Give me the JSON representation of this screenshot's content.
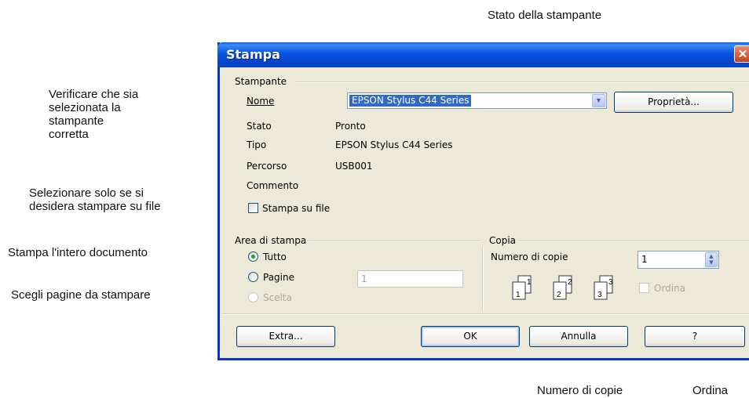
{
  "annotations": {
    "printer_status": "Stato della stampante",
    "verify_printer": "Verificare che sia\nselezionata la\nstampante\ncorretta",
    "print_to_file_hint": "Selezionare solo se si\ndesidera stampare su file",
    "print_all_hint": "Stampa l'intero documento",
    "choose_pages_hint": "Scegli pagine da stampare",
    "copies_hint": "Numero di copie",
    "collate_hint": "Ordina"
  },
  "dialog": {
    "title": "Stampa",
    "close_icon": "close-icon",
    "printer_group": {
      "title": "Stampante",
      "name_label": "Nome",
      "name_value": "EPSON Stylus C44 Series",
      "properties_button": "Proprietà...",
      "status_label": "Stato",
      "status_value": "Pronto",
      "type_label": "Tipo",
      "type_value": "EPSON Stylus C44 Series",
      "path_label": "Percorso",
      "path_value": "USB001",
      "comment_label": "Commento",
      "print_to_file_label": "Stampa su file",
      "print_to_file_checked": false
    },
    "print_range": {
      "title": "Area di stampa",
      "all_label": "Tutto",
      "pages_label": "Pagine",
      "pages_value": "1",
      "selection_label": "Scelta",
      "selected": "all"
    },
    "copies": {
      "title": "Copia",
      "count_label": "Numero di copie",
      "count_value": "1",
      "collate_label": "Ordina",
      "collate_checked": false,
      "collate_icons": [
        "1",
        "1",
        "2",
        "2",
        "3",
        "3"
      ]
    },
    "buttons": {
      "extra": "Extra...",
      "ok": "OK",
      "cancel": "Annulla",
      "help": "?"
    }
  },
  "colors": {
    "dialog_bg": "#ece9d8",
    "titlebar": "#0752e0",
    "selection": "#316ac5",
    "radio_dot": "#21a121"
  }
}
